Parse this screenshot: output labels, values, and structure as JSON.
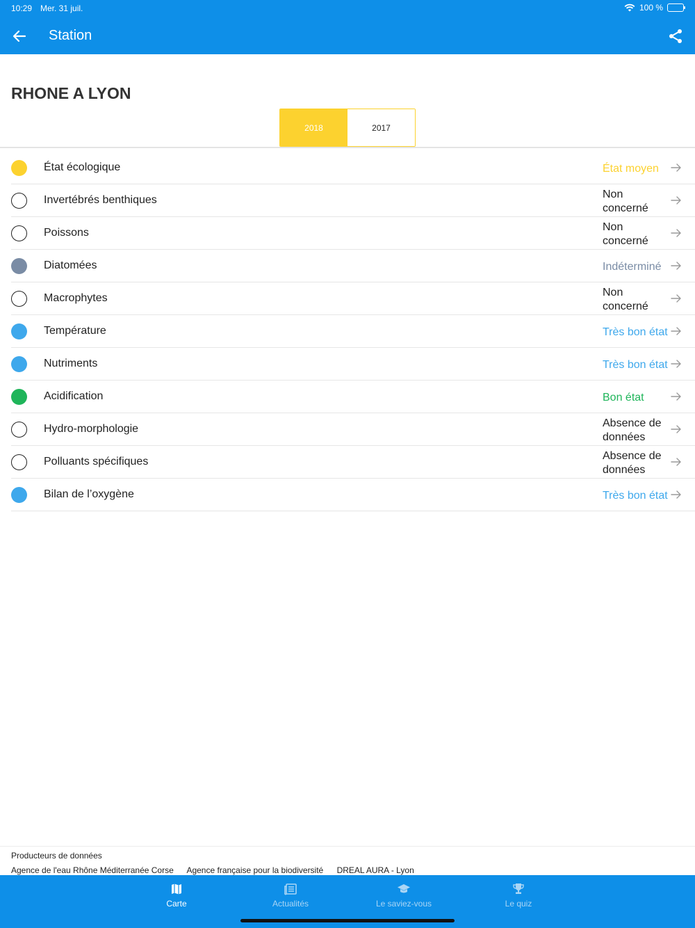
{
  "status_bar": {
    "time": "10:29",
    "date": "Mer. 31 juil.",
    "battery": "100 %"
  },
  "header": {
    "title": "Station"
  },
  "station": {
    "name": "RHONE A LYON"
  },
  "years": [
    {
      "label": "2018",
      "selected": true
    },
    {
      "label": "2017",
      "selected": false
    }
  ],
  "colors": {
    "primary": "#0e8fe8",
    "moyen": "#fcd22f",
    "indetermine": "#7a8ca5",
    "tres_bon": "#3ea8ec",
    "bon": "#1fb55a",
    "neutral": "#222222"
  },
  "indicators": [
    {
      "label": "État écologique",
      "value": "État moyen",
      "status": "moyen"
    },
    {
      "label": "Invertébrés benthiques",
      "value": "Non concerné",
      "status": "none"
    },
    {
      "label": "Poissons",
      "value": "Non concerné",
      "status": "none"
    },
    {
      "label": "Diatomées",
      "value": "Indéterminé",
      "status": "indetermine"
    },
    {
      "label": "Macrophytes",
      "value": "Non concerné",
      "status": "none"
    },
    {
      "label": "Température",
      "value": "Très bon état",
      "status": "tres_bon"
    },
    {
      "label": "Nutriments",
      "value": "Très bon état",
      "status": "tres_bon"
    },
    {
      "label": "Acidification",
      "value": "Bon état",
      "status": "bon"
    },
    {
      "label": "Hydro-morphologie",
      "value": "Absence de données",
      "status": "none"
    },
    {
      "label": "Polluants spécifiques",
      "value": "Absence de données",
      "status": "none"
    },
    {
      "label": "Bilan de l’oxygène",
      "value": "Très bon état",
      "status": "tres_bon"
    }
  ],
  "producers": {
    "title": "Producteurs de données",
    "items": [
      "Agence de l'eau Rhône Méditerranée Corse",
      "Agence française pour la biodiversité",
      "DREAL AURA - Lyon"
    ]
  },
  "tabs": [
    {
      "label": "Carte",
      "icon": "map-icon",
      "active": true
    },
    {
      "label": "Actualités",
      "icon": "news-icon",
      "active": false
    },
    {
      "label": "Le saviez-vous",
      "icon": "graduation-cap-icon",
      "active": false
    },
    {
      "label": "Le quiz",
      "icon": "trophy-icon",
      "active": false
    }
  ]
}
